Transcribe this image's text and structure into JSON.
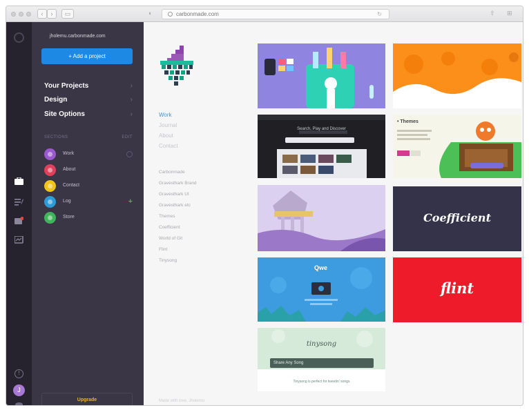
{
  "browser": {
    "url": "carbonmade.com",
    "nav": {
      "back": "‹",
      "forward": "›",
      "sidebar": "▭"
    },
    "icons": [
      "lock-icon",
      "reload-icon",
      "share-icon",
      "tabs-icon"
    ]
  },
  "rail": {
    "icons": [
      "logo-icon",
      "portfolio-icon",
      "edit-icon",
      "inbox-icon",
      "stats-icon",
      "help-icon",
      "avatar",
      "preview-icon"
    ],
    "badge_color": "#e8453c",
    "avatar_initial": "J"
  },
  "sidebar": {
    "user": "jholemu.carbonmade.com",
    "add_project": "+ Add a project",
    "nav": [
      {
        "label": "Your Projects"
      },
      {
        "label": "Design"
      },
      {
        "label": "Site Options"
      }
    ],
    "sections_heading": "SECTIONS",
    "sections_action": "EDIT",
    "sections": [
      {
        "label": "Work",
        "color": "#9b59d0"
      },
      {
        "label": "About",
        "color": "#e0405a"
      },
      {
        "label": "Contact",
        "color": "#f0c419"
      },
      {
        "label": "Log",
        "color": "#2f9bd6"
      },
      {
        "label": "Store",
        "color": "#3fb45a"
      }
    ],
    "add_section": "+",
    "upgrade": "Upgrade"
  },
  "site": {
    "nav": [
      "Work",
      "Journal",
      "About",
      "Contact"
    ],
    "projects": [
      "Carbonmade",
      "Gravesthark Brand",
      "Gravesthark UI",
      "Gravesthark etc",
      "Themes",
      "Coefficient",
      "World of Git",
      "Flint",
      "Tinysong"
    ],
    "footer": "Made with love, Jholemu",
    "tiles": {
      "themes_label": "• Themes",
      "blackbox_heading": "Search, Play and Discover",
      "coefficient": "Coefficient",
      "flint": "flint",
      "qwe": "Qwe",
      "tinysong": "tinysong",
      "tinysong_search": "Share Any Song",
      "tinysong_footer": "Tinysong is perfect for tweetin' songs"
    }
  }
}
